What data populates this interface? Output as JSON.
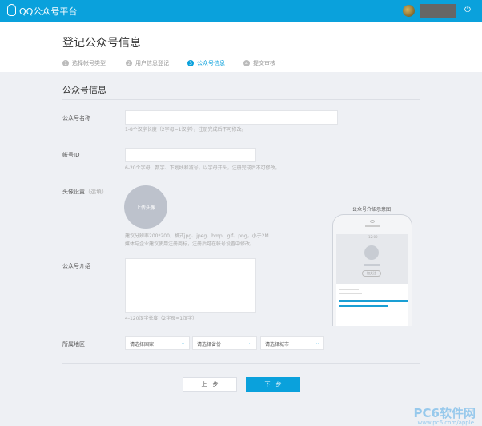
{
  "topbar": {
    "logo": "QQ公众号平台"
  },
  "header": {
    "title": "登记公众号信息",
    "steps": [
      {
        "num": "1",
        "label": "选择帐号类型"
      },
      {
        "num": "2",
        "label": "用户信息登记"
      },
      {
        "num": "3",
        "label": "公众号信息"
      },
      {
        "num": "4",
        "label": "提交审核"
      }
    ]
  },
  "form": {
    "section_title": "公众号信息",
    "name": {
      "label": "公众号名称",
      "value": "",
      "hint": "1-8个汉字长度（2字母=1汉字），注册完成后不可修改。"
    },
    "id": {
      "label": "帐号ID",
      "value": "",
      "hint": "6-20个字母、数字、下划线和减号，以字母开头，注册完成后不可修改。"
    },
    "avatar": {
      "label": "头像设置",
      "optional": "（选填）",
      "upload": "上传头像",
      "hint1": "建议分辨率200*200，格式jpg、jpeg、bmp、gif、png，小于2M",
      "hint2": "媒体与企业建议使用注册商标，注册后可在帐号设置中修改。"
    },
    "intro": {
      "label": "公众号介绍",
      "value": "",
      "hint": "4-120汉字长度（2字母=1汉字）"
    },
    "region": {
      "label": "所属地区",
      "country": "请选择国家",
      "province": "请选择省份",
      "city": "请选择城市"
    },
    "prev": "上一步",
    "next": "下一步"
  },
  "preview": {
    "caption": "公众号介绍示意图",
    "time": "12:00",
    "follow": "加关注"
  },
  "watermark": {
    "text": "PC6软件网",
    "url": "www.pc6.com/apple"
  }
}
